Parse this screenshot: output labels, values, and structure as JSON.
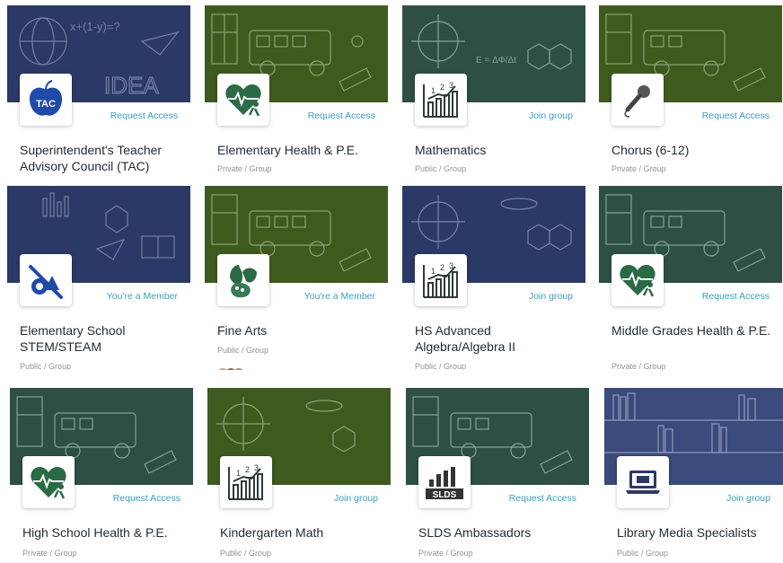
{
  "colors": {
    "action": "#3a9fbf",
    "title": "#1d2b36",
    "meta": "#8a949c",
    "navy": "#2b3966",
    "olive": "#3f5a1e",
    "teal": "#2e4f44"
  },
  "groups": [
    {
      "title": "Superintendent's Teacher Advisory Council (TAC)",
      "meta": "",
      "action": "Request Access",
      "icon": "apple-tac-icon",
      "banner": "navy"
    },
    {
      "title": "Elementary Health & P.E.",
      "meta": "Private / Group",
      "action": "Request Access",
      "icon": "heart-runner-icon",
      "banner": "olive"
    },
    {
      "title": "Mathematics",
      "meta": "Public / Group",
      "action": "Join group",
      "icon": "math-chart-icon",
      "banner": "teal"
    },
    {
      "title": "Chorus (6-12)",
      "meta": "Private / Group",
      "action": "Request Access",
      "icon": "microphone-icon",
      "banner": "olive"
    },
    {
      "title": "Elementary School STEM/STEAM",
      "meta": "Public / Group",
      "action": "You're a Member",
      "icon": "stem-tools-icon",
      "banner": "navy"
    },
    {
      "title": "Fine Arts",
      "meta": "Public / Group",
      "action": "You're a Member",
      "icon": "arts-masks-icon",
      "banner": "olive"
    },
    {
      "title": "HS Advanced Algebra/Algebra II",
      "meta": "Public / Group",
      "action": "Join group",
      "icon": "math-chart-icon",
      "banner": "navy"
    },
    {
      "title": "Middle Grades Health & P.E.",
      "meta": "Private / Group",
      "action": "Request Access",
      "icon": "heart-runner-icon",
      "banner": "teal"
    },
    {
      "title": "High School Health & P.E.",
      "meta": "Private / Group",
      "action": "Request Access",
      "icon": "heart-runner-icon",
      "banner": "teal"
    },
    {
      "title": "Kindergarten Math",
      "meta": "Public / Group",
      "action": "Join group",
      "icon": "math-chart-icon",
      "banner": "olive"
    },
    {
      "title": "SLDS Ambassadors",
      "meta": "Private / Group",
      "action": "Request Access",
      "icon": "slds-logo-icon",
      "banner": "teal"
    },
    {
      "title": "Library Media Specialists",
      "meta": "Public / Group",
      "action": "Join group",
      "icon": "laptop-library-icon",
      "banner": "navy"
    }
  ]
}
